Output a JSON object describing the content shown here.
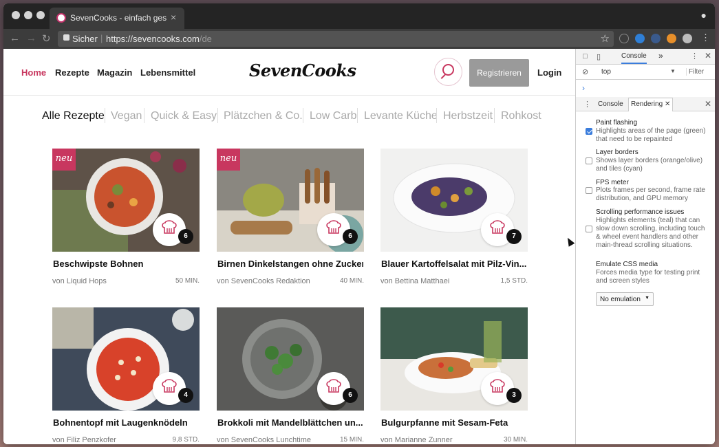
{
  "browser": {
    "tab_title": "SevenCooks - einfach gesund",
    "tab_close": "×",
    "secure_label": "Sicher",
    "url_host": "https://sevencooks.com",
    "url_path": "/de"
  },
  "site": {
    "nav": [
      "Home",
      "Rezepte",
      "Magazin",
      "Lebensmittel"
    ],
    "logo": "SevenCooks",
    "register_label": "Registrieren",
    "login_label": "Login"
  },
  "categories": [
    "Alle Rezepte",
    "Vegan",
    "Quick & Easy",
    "Plätzchen & Co.",
    "Low Carb",
    "Levante Küche",
    "Herbstzeit",
    "Rohkost"
  ],
  "badge_label": "neu",
  "recipes": [
    {
      "title": "Beschwipste Bohnen",
      "author": "von Liquid Hops",
      "time": "50 MIN.",
      "chef_count": "6",
      "is_new": true
    },
    {
      "title": "Birnen Dinkelstangen ohne Zucker",
      "author": "von SevenCooks Redaktion",
      "time": "40 MIN.",
      "chef_count": "6",
      "is_new": true
    },
    {
      "title": "Blauer Kartoffelsalat mit Pilz-Vin...",
      "author": "von Bettina Matthaei",
      "time": "1,5 STD.",
      "chef_count": "7",
      "is_new": false
    },
    {
      "title": "Bohnentopf mit Laugenknödeln",
      "author": "von Filiz Penzkofer",
      "time": "9,8 STD.",
      "chef_count": "4",
      "is_new": false
    },
    {
      "title": "Brokkoli mit Mandelblättchen un...",
      "author": "von SevenCooks Lunchtime",
      "time": "15 MIN.",
      "chef_count": "6",
      "is_new": false
    },
    {
      "title": "Bulgurpfanne mit Sesam-Feta",
      "author": "von Marianne Zunner",
      "time": "30 MIN.",
      "chef_count": "3",
      "is_new": false
    }
  ],
  "devtools": {
    "main_tab": "Console",
    "more": "»",
    "context": "top",
    "filter_placeholder": "Filter",
    "prompt": "›",
    "drawer_tabs": [
      "Console",
      "Rendering"
    ],
    "options": [
      {
        "title": "Paint flashing",
        "desc": "Highlights areas of the page (green) that need to be repainted",
        "checked": true
      },
      {
        "title": "Layer borders",
        "desc": "Shows layer borders (orange/olive) and tiles (cyan)",
        "checked": false
      },
      {
        "title": "FPS meter",
        "desc": "Plots frames per second, frame rate distribution, and GPU memory",
        "checked": false
      },
      {
        "title": "Scrolling performance issues",
        "desc": "Highlights elements (teal) that can slow down scrolling, including touch & wheel event handlers and other main-thread scrolling situations.",
        "checked": false
      }
    ],
    "emulate_title": "Emulate CSS media",
    "emulate_desc": "Forces media type for testing print and screen styles",
    "emulate_value": "No emulation"
  },
  "colors": {
    "brand": "#c8375f",
    "checkbox": "#3b7ddc"
  }
}
